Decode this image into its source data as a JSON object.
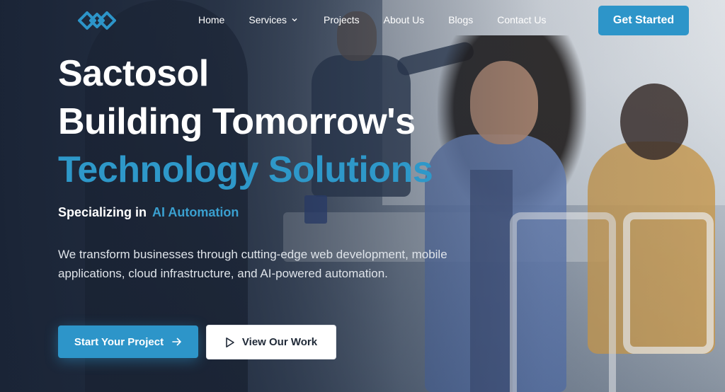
{
  "brand": {
    "logo_icon": "linked-puzzle-logo-icon",
    "accent_color": "#2d95c9"
  },
  "nav": {
    "items": [
      {
        "label": "Home"
      },
      {
        "label": "Services",
        "has_dropdown": true,
        "dropdown_icon": "chevron-down-icon"
      },
      {
        "label": "Projects"
      },
      {
        "label": "About Us"
      },
      {
        "label": "Blogs"
      },
      {
        "label": "Contact Us"
      }
    ],
    "cta_label": "Get Started"
  },
  "hero": {
    "title_line1": "Sactosol",
    "title_line2": "Building Tomorrow's",
    "title_accent": "Technology Solutions",
    "specializing_prefix": "Specializing in",
    "specializing_value": "AI Automation",
    "description": "We transform businesses through cutting-edge web development, mobile applications, cloud infrastructure, and AI-powered automation.",
    "primary_button": {
      "label": "Start Your Project",
      "icon": "arrow-right-icon"
    },
    "secondary_button": {
      "label": "View Our Work",
      "icon": "play-icon"
    }
  },
  "colors": {
    "primary": "#2d95c9",
    "accent_text": "#2e98c9",
    "text_light": "#ffffff"
  }
}
